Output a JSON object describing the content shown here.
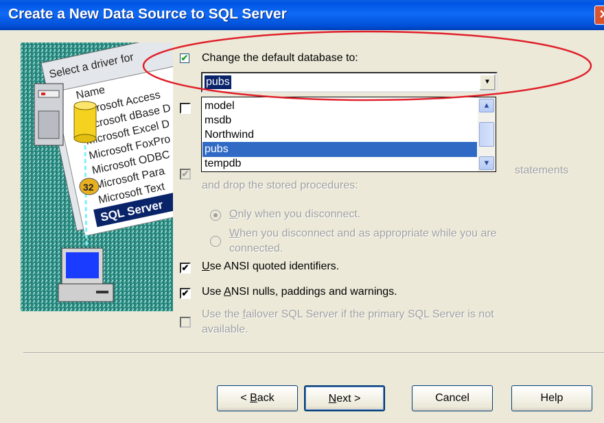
{
  "window": {
    "title": "Create a New Data Source to SQL Server",
    "close_glyph": "✕"
  },
  "illustration": {
    "icon": "odbc-wizard-illustration",
    "lines": [
      "Select a driver for",
      "Name",
      "Microsoft Access",
      "Microsoft dBase D",
      "Microsoft Excel D",
      "Microsoft FoxPro",
      "Microsoft ODBC",
      "Microsoft Para",
      "Microsoft Text",
      "SQL Server"
    ]
  },
  "options": {
    "change_db": {
      "label": "Change the default database to:",
      "checked": true,
      "check_glyph": "✔"
    },
    "db_combo": {
      "value": "pubs",
      "arrow_glyph": "▼"
    },
    "db_list": {
      "items": [
        "model",
        "msdb",
        "Northwind",
        "pubs",
        "tempdb"
      ],
      "selected": "pubs",
      "scroll_up_glyph": "▲",
      "scroll_down_glyph": "▼"
    },
    "checkbox2": {
      "checked": false
    },
    "create_sp": {
      "label_tail": "statements",
      "label_line2": "and drop the stored procedures:",
      "check_glyph": "✔"
    },
    "radio_only": {
      "label_pre": "",
      "label_accel": "O",
      "label_post": "nly when you disconnect."
    },
    "radio_when": {
      "label_accel": "W",
      "label_post": "hen you disconnect and as appropriate while you are",
      "label_line2": "connected."
    },
    "ansi_quoted": {
      "label_accel": "U",
      "label_post": "se ANSI quoted identifiers.",
      "check_glyph": "✔"
    },
    "ansi_nulls": {
      "label_pre": "Use ",
      "label_accel": "A",
      "label_post": "NSI nulls, paddings and warnings.",
      "check_glyph": "✔"
    },
    "failover": {
      "label_pre": "Use the ",
      "label_accel": "f",
      "label_post": "ailover SQL Server if the primary SQL Server is not",
      "label_line2": "available."
    }
  },
  "buttons": {
    "back": {
      "pre": "< ",
      "accel": "B",
      "post": "ack"
    },
    "next": {
      "pre": "",
      "accel": "N",
      "post": "ext >"
    },
    "cancel": "Cancel",
    "help": "Help"
  },
  "annotation": {
    "shape": "red-ellipse",
    "color": "#e0202a"
  },
  "colors": {
    "title_bar": "#0054e3",
    "selection": "#316ac5",
    "dialog_bg": "#ece9d8"
  }
}
